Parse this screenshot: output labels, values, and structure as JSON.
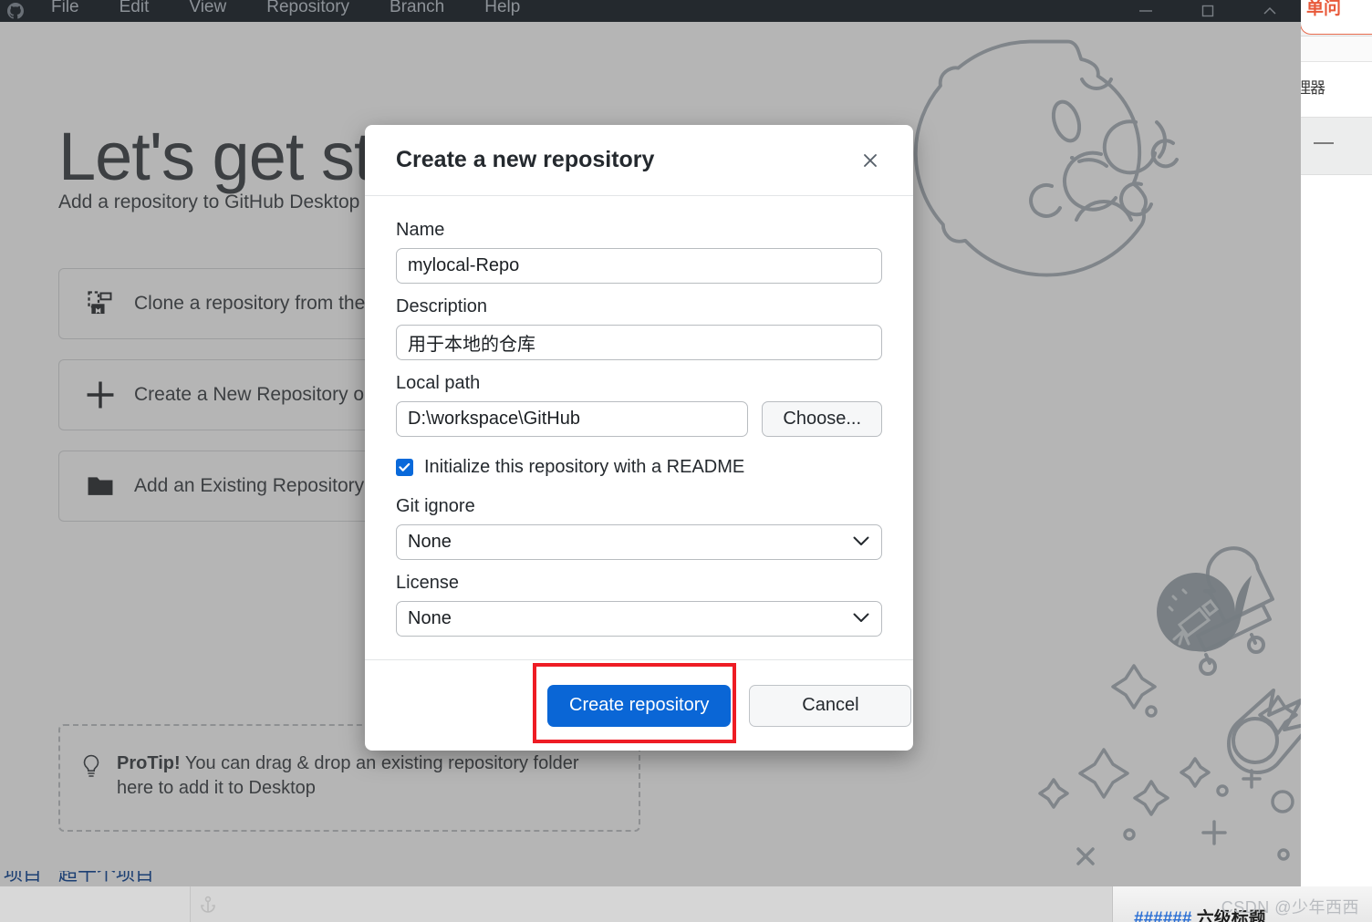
{
  "window": {
    "app_title": "GitHub Desktop",
    "menu": [
      "File",
      "Edit",
      "View",
      "Repository",
      "Branch",
      "Help"
    ],
    "controls": {
      "minimize": "minimize-icon",
      "maximize": "maximize-icon",
      "close": "close-icon"
    }
  },
  "blank_slate": {
    "title": "Let's get started!",
    "subtitle": "Add a repository to GitHub Desktop to start collaborating",
    "actions": [
      {
        "label": "Clone a repository from the Internet...",
        "icon": "clone-repository-icon"
      },
      {
        "label": "Create a New Repository on your local drive...",
        "icon": "plus-icon"
      },
      {
        "label": "Add an Existing Repository from your local drive...",
        "icon": "folder-icon"
      }
    ],
    "protip": {
      "icon": "lightbulb-icon",
      "prefix": "ProTip!",
      "text": " You can drag & drop an existing repository folder here to add it to Desktop"
    }
  },
  "dialog": {
    "title": "Create a new repository",
    "close_icon": "close-icon",
    "fields": {
      "name": {
        "label": "Name",
        "value": "mylocal-Repo",
        "placeholder": ""
      },
      "description": {
        "label": "Description",
        "value": "用于本地的仓库",
        "placeholder": ""
      },
      "local_path": {
        "label": "Local path",
        "value": "D:\\workspace\\GitHub",
        "choose_label": "Choose..."
      },
      "readme": {
        "label": "Initialize this repository with a README",
        "checked": true
      },
      "gitignore": {
        "label": "Git ignore",
        "value": "None",
        "options": [
          "None"
        ]
      },
      "license": {
        "label": "License",
        "value": "None",
        "options": [
          "None"
        ]
      }
    },
    "buttons": {
      "primary": "Create repository",
      "secondary": "Cancel"
    }
  },
  "annotation": {
    "color": "#ee1c24",
    "target": "create-repository-button"
  },
  "background": {
    "browser_tab_text": "单问",
    "page_label": "理器",
    "markdown_hashes": "######",
    "markdown_heading": "六级标题",
    "cut_text_left": "项目",
    "cut_text_mid": "超十个项目"
  },
  "watermark": "CSDN @少年西西",
  "colors": {
    "accent": "#0a66d6",
    "checkbox": "#0969da",
    "titlebar": "#24292e",
    "annotation": "#ee1c24",
    "text": "#24292e"
  }
}
